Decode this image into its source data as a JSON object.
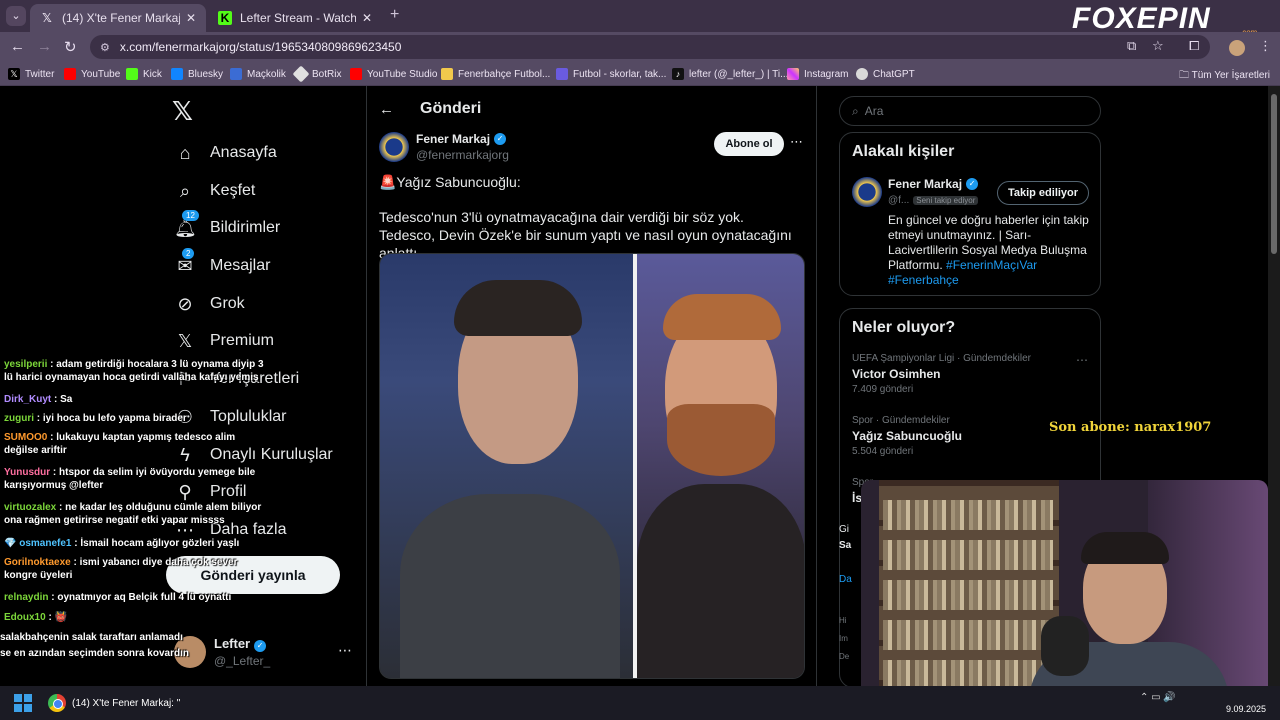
{
  "browser": {
    "tabs": [
      {
        "title": "(14) X'te Fener Markaj: \"🚨Yağ",
        "active": true,
        "favicon": "x-icon"
      },
      {
        "title": "Lefter Stream - Watch Live on K",
        "active": false,
        "favicon": "kick-icon"
      }
    ],
    "url": "x.com/fenermarkajorg/status/1965340809869623450",
    "bookmarks": [
      "Twitter",
      "YouTube",
      "Kick",
      "Bluesky",
      "Maçkolik",
      "BotRix",
      "YouTube Studio",
      "Fenerbahçe Futbol...",
      "Futbol - skorlar, tak...",
      "lefter (@_lefter_) | Ti...",
      "Instagram",
      "ChatGPT"
    ],
    "all_bookmarks": "Tüm Yer İşaretleri"
  },
  "overlay": {
    "brand": "FOXEPIN",
    "brand_sub": ".com",
    "last_sub": "Son abone: narax1907"
  },
  "sidebar": {
    "items": [
      {
        "label": "Anasayfa",
        "icon": "home-icon"
      },
      {
        "label": "Keşfet",
        "icon": "search-icon"
      },
      {
        "label": "Bildirimler",
        "icon": "bell-icon",
        "badge": "12"
      },
      {
        "label": "Mesajlar",
        "icon": "mail-icon",
        "badge": "2"
      },
      {
        "label": "Grok",
        "icon": "grok-icon"
      },
      {
        "label": "Premium",
        "icon": "x-premium-icon"
      },
      {
        "label": "Yer İşaretleri",
        "icon": "bookmark-icon"
      },
      {
        "label": "Topluluklar",
        "icon": "communities-icon"
      },
      {
        "label": "Onaylı Kuruluşlar",
        "icon": "lightning-icon"
      },
      {
        "label": "Profil",
        "icon": "profile-icon"
      },
      {
        "label": "Daha fazla",
        "icon": "more-icon"
      }
    ],
    "post_button": "Gönderi yayınla",
    "user": {
      "name": "Lefter",
      "handle": "@_Lefter_"
    }
  },
  "post": {
    "header": "Gönderi",
    "author": "Fener Markaj",
    "handle": "@fenermarkajorg",
    "subscribe": "Abone ol",
    "line1": "🚨Yağız Sabuncuoğlu:",
    "body": "Tedesco'nun 3'lü oynatmayacağına dair verdiği bir söz yok. Tedesco, Devin Özek'e bir sunum yaptı ve nasıl oyun oynatacağını anlattı."
  },
  "right": {
    "search_placeholder": "Ara",
    "related_title": "Alakalı kişiler",
    "related": {
      "name": "Fener Markaj",
      "handle": "@f...",
      "follows_you": "Seni takip ediyor",
      "follow_btn": "Takip ediliyor",
      "bio": "En güncel ve doğru haberler için takip etmeyi unutmayınız. | Sarı-Lacivertlilerin Sosyal Medya Buluşma Platformu.",
      "tags": "#FenerinMaçıVar #Fenerbahçe"
    },
    "trends_title": "Neler oluyor?",
    "trends": [
      {
        "category": "UEFA Şampiyonlar Ligi · Gündemdekiler",
        "title": "Victor Osimhen",
        "count": "7.409 gönderi"
      },
      {
        "category": "Spor · Gündemdekiler",
        "title": "Yağız Sabuncuoğlu",
        "count": "5.504 gönderi"
      },
      {
        "category": "Spor",
        "title": "İs",
        "count": ""
      }
    ],
    "partial": [
      "Gi",
      "Sa",
      "Da",
      "Hi",
      "Im",
      "De"
    ]
  },
  "chat": [
    {
      "user": "yesilperii",
      "color": "#7cd63a",
      "text": "adam getirdiği hocalara 3 lü oynama diyip 3 lü harici oynamayan hoca getirdi vallaha kafayı yemiş"
    },
    {
      "user": "Dirk_Kuyt",
      "color": "#b18cff",
      "text": "Sa"
    },
    {
      "user": "zuguri",
      "color": "#7cd63a",
      "text": "iyi hoca bu lefo yapma birader"
    },
    {
      "user": "SUMOO0",
      "color": "#ff9a2e",
      "text": "lukakuyu kaptan yapmış tedesco alim değilse ariftir"
    },
    {
      "user": "Yunusdur",
      "color": "#ff6fa0",
      "text": "htspor da selim iyi övüyordu yemege bile karışıyormuş @lefter"
    },
    {
      "user": "virtuozalex",
      "color": "#7cd63a",
      "text": "ne kadar leş olduğunu cümle alem biliyor ona rağmen getirirse negatif etki yapar missss"
    },
    {
      "user": "osmanefe1",
      "color": "#4fc3ff",
      "text": "İsmail hocam ağlıyor gözleri yaşlı"
    },
    {
      "user": "Gorilnoktaexe",
      "color": "#ff9a2e",
      "text": "ismi yabancı diye daha çok sever kongre üyeleri"
    },
    {
      "user": "relnaydin",
      "color": "#7cd63a",
      "text": "oynatmıyor aq Belçik full 4 lü oynattı"
    },
    {
      "user": "Edoux10",
      "color": "#7cd63a",
      "text": "👹"
    },
    {
      "user": "",
      "color": "#ffffff",
      "text": "salakbahçenin salak taraftarı anlamadı"
    },
    {
      "user": "",
      "color": "#ffffff",
      "text": "se en azından seçimden sonra kovardın"
    }
  ],
  "taskbar": {
    "app_title": "(14) X'te Fener Markaj: \"",
    "date": "9.09.2025"
  },
  "colors": {
    "accent": "#1d9bf0",
    "chrome_bg": "#3b3046",
    "chrome_toolbar": "#554a63"
  }
}
